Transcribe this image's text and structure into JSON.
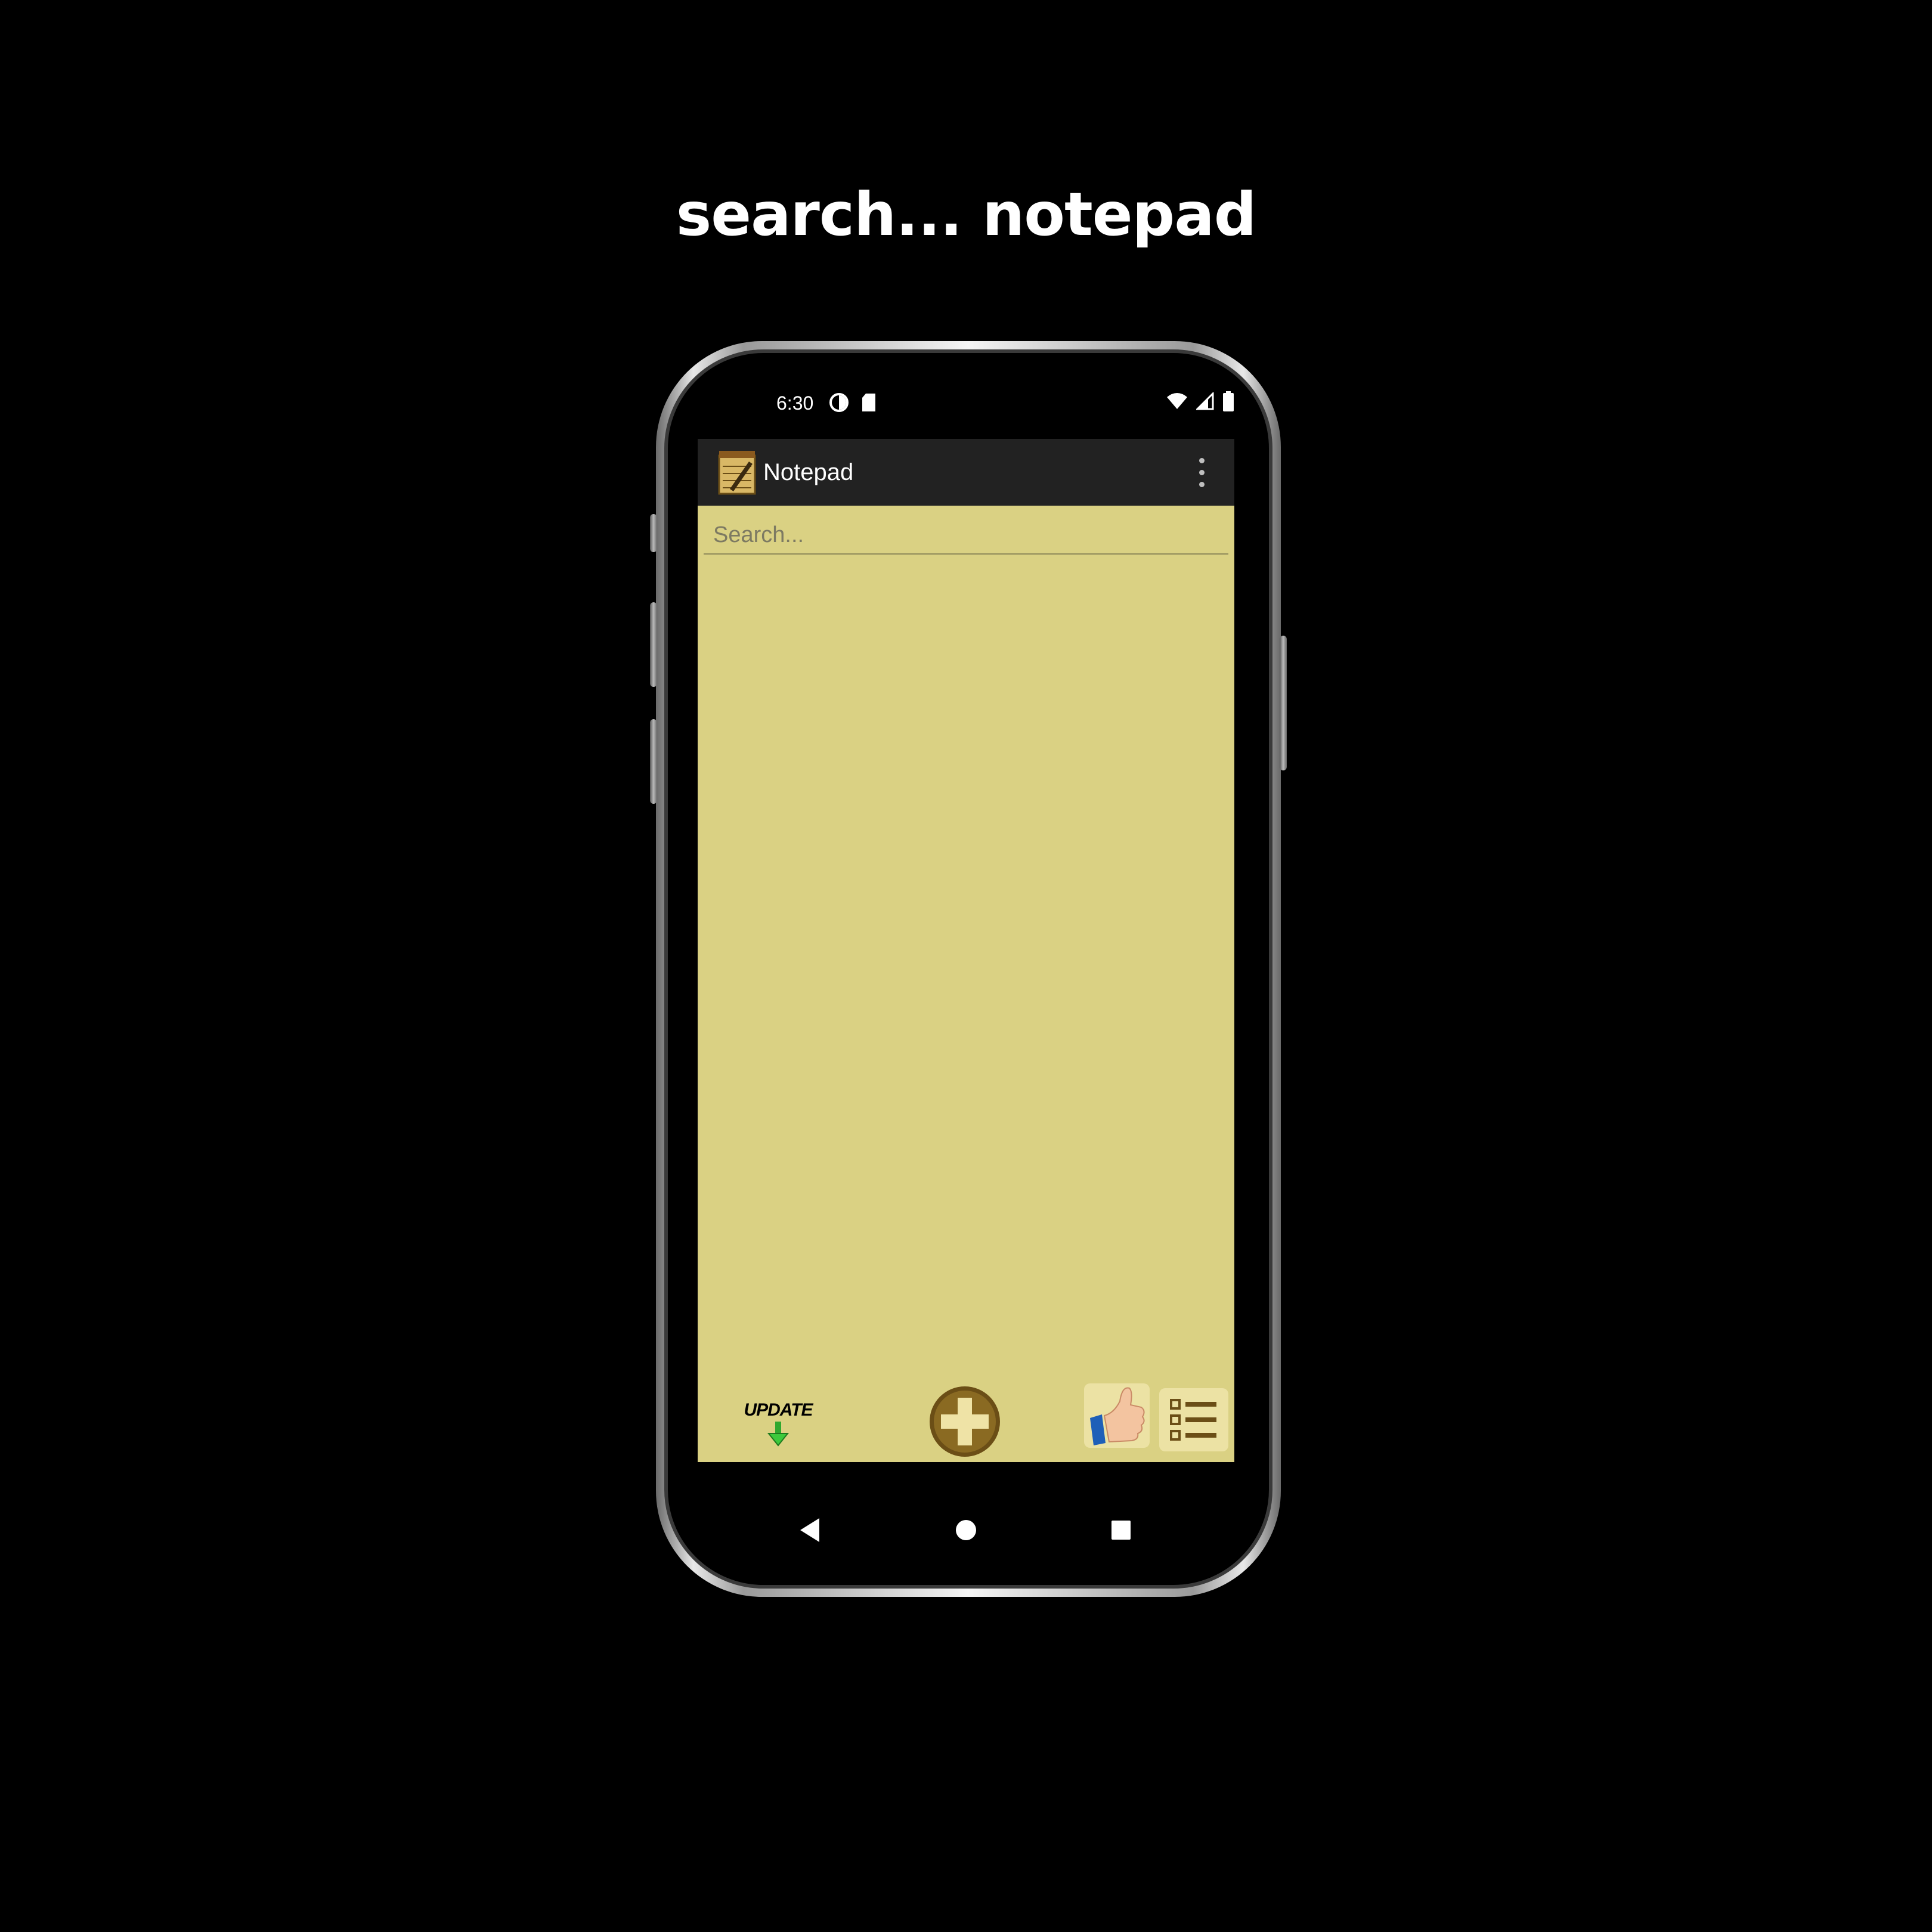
{
  "headline": "search... notepad",
  "status_bar": {
    "time": "6:30",
    "left_icons": [
      "data-saver-icon",
      "sd-card-icon"
    ],
    "right_icons": [
      "wifi-icon",
      "cell-signal-icon",
      "battery-icon"
    ]
  },
  "app_bar": {
    "title": "Notepad",
    "logo_icon": "notepad-logo-icon",
    "menu_icon": "overflow-menu-icon"
  },
  "search": {
    "placeholder": "Search...",
    "value": ""
  },
  "bottom_bar": {
    "update_label": "UPDATE",
    "buttons": [
      "update-button",
      "add-note-button",
      "rate-app-button",
      "list-view-button"
    ]
  },
  "nav_bar": {
    "buttons": [
      "back-icon",
      "home-icon",
      "recents-icon"
    ]
  },
  "colors": {
    "background": "#000000",
    "app_bar": "#222222",
    "content": "#dad183",
    "accent_brown": "#6b4e16",
    "button_tile": "#ece2a4"
  }
}
